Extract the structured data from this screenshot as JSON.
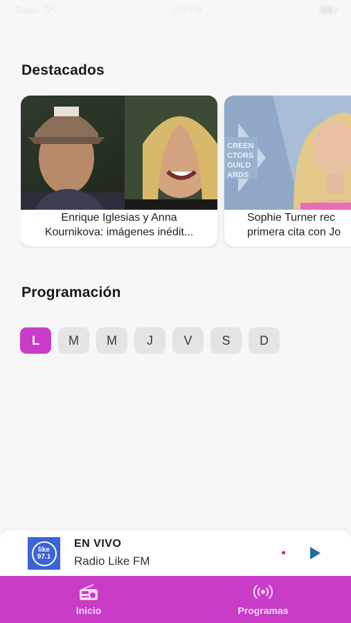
{
  "status_bar": {
    "carrier": "Radio",
    "time": "2:08 PM"
  },
  "featured": {
    "title": "Destacados",
    "cards": [
      {
        "line1": "Enrique Iglesias y Anna",
        "line2": "Kournikova: imágenes inédit..."
      },
      {
        "line1": "Sophie Turner rec",
        "line2": "primera cita con Jo"
      }
    ]
  },
  "schedule": {
    "title": "Programación",
    "days": [
      "L",
      "M",
      "M",
      "J",
      "V",
      "S",
      "D"
    ],
    "active_day": "L"
  },
  "player": {
    "logo_text": "like 97.1",
    "live_label": "EN VIVO",
    "station": "Radio Like FM",
    "live_dot_color": "#e0202a",
    "play_icon": "play-icon"
  },
  "tabs": {
    "home": "Inicio",
    "programs": "Programas"
  },
  "colors": {
    "accent": "#c93cc8",
    "play": "#1d6fa8",
    "logo_bg": "#3a64d8"
  }
}
